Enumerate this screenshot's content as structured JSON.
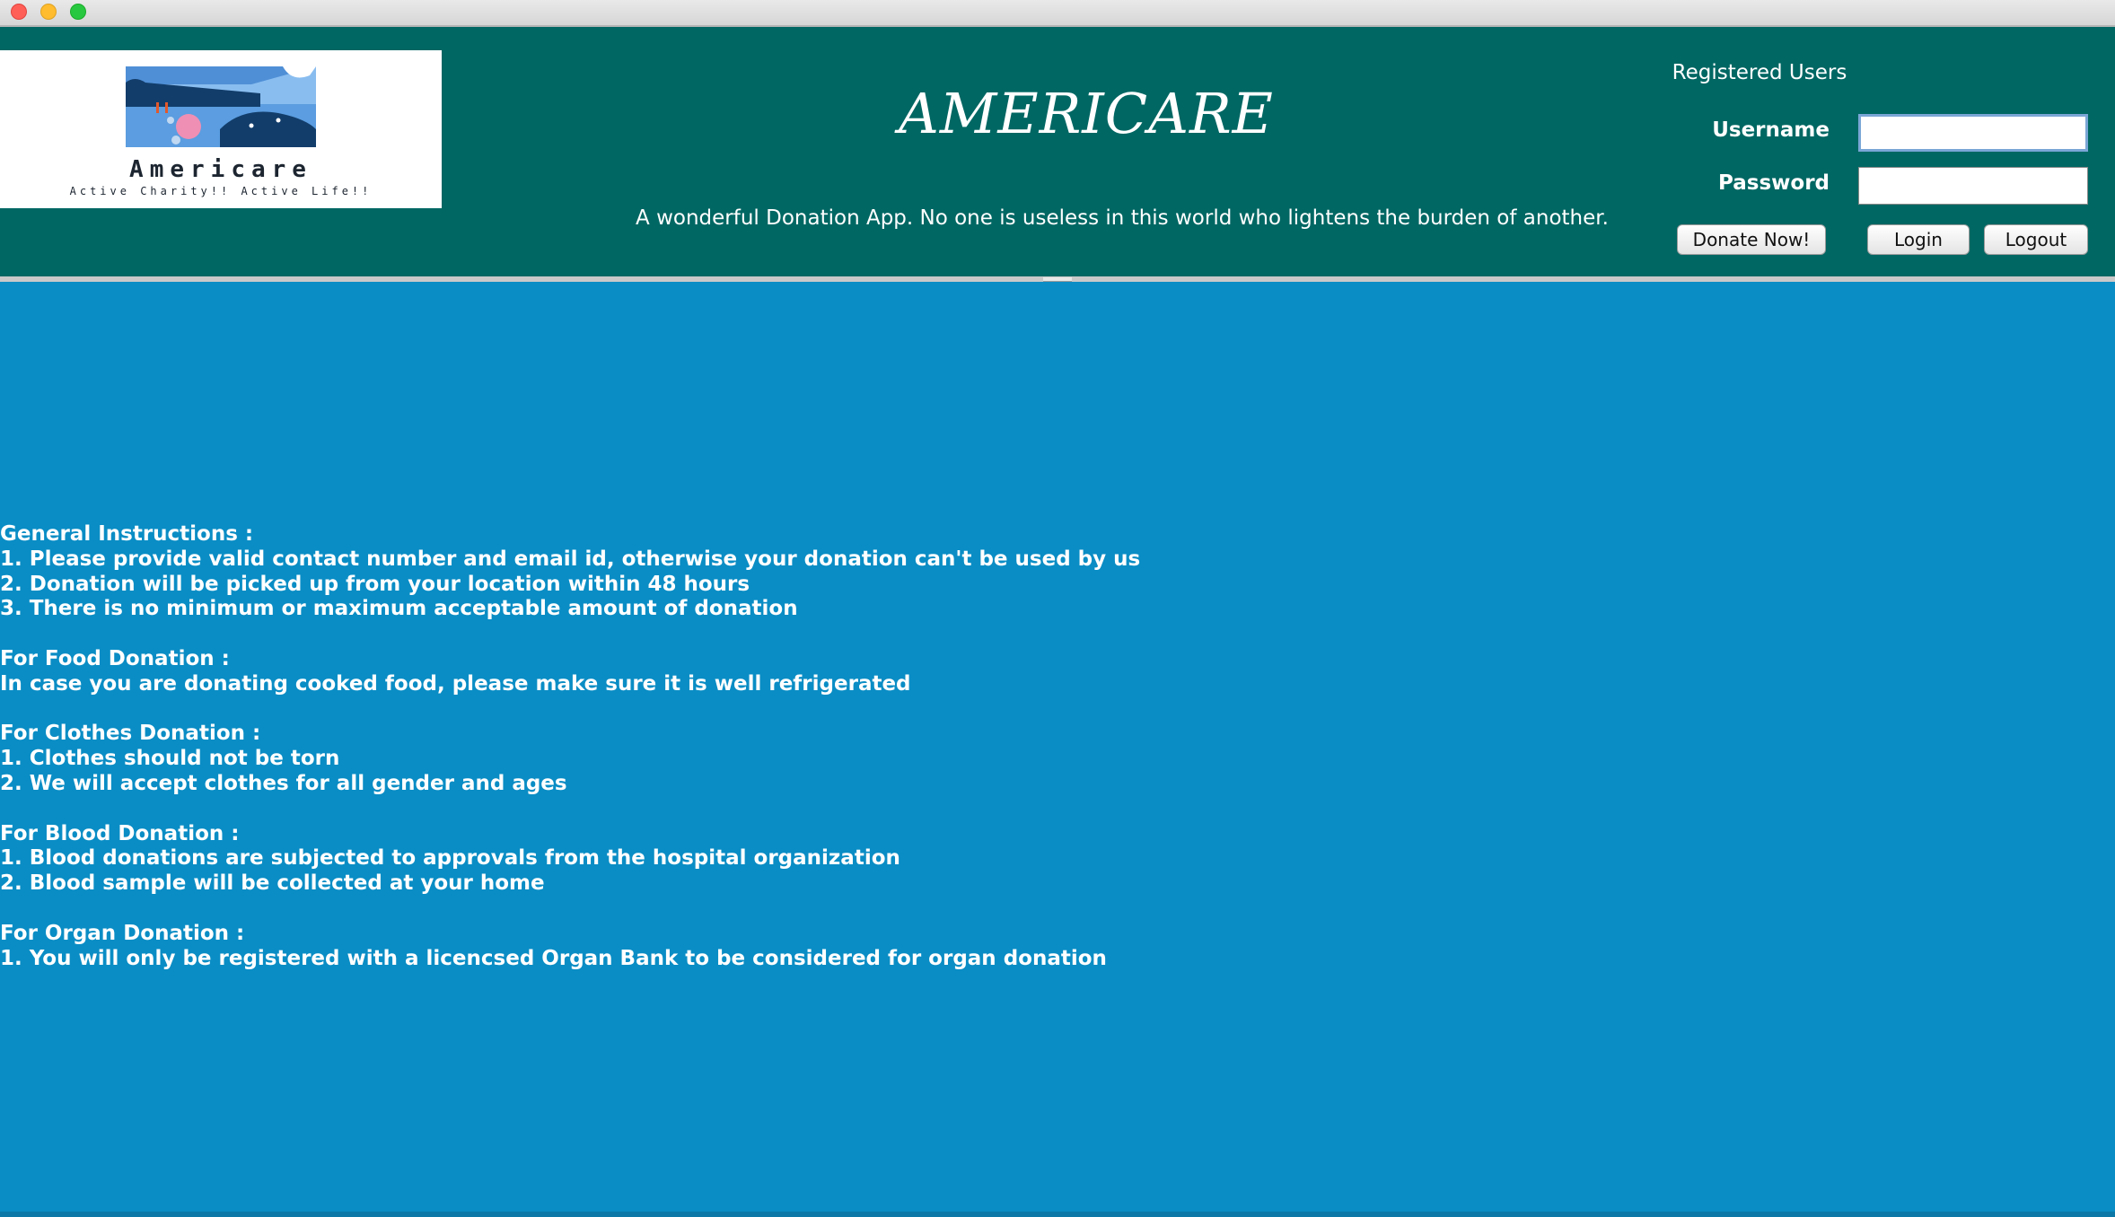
{
  "header": {
    "logo": {
      "name": "Americare",
      "tagline": "Active Charity!! Active Life!!"
    },
    "title": "AMERICARE",
    "tagline": "A wonderful Donation App. No one is useless in this world who lightens the burden of another."
  },
  "login": {
    "heading": "Registered Users",
    "username_label": "Username",
    "password_label": "Password",
    "username_value": "",
    "password_value": "",
    "donate_label": "Donate Now!",
    "login_label": "Login",
    "logout_label": "Logout"
  },
  "instructions": [
    {
      "heading": "General Instructions :",
      "lines": [
        "1. Please provide valid contact number and email id, otherwise your donation can't be used by us",
        "2. Donation will be picked up from your location within 48 hours",
        "3. There is no minimum or maximum acceptable amount of donation"
      ]
    },
    {
      "heading": "For Food Donation :",
      "lines": [
        "In case you are donating cooked food, please make sure it is well refrigerated"
      ]
    },
    {
      "heading": "For Clothes Donation :",
      "lines": [
        "1. Clothes should not be torn",
        "2. We will accept clothes for all gender and ages"
      ]
    },
    {
      "heading": "For Blood Donation :",
      "lines": [
        "1. Blood donations are subjected to approvals from the hospital organization",
        "2. Blood sample will be collected at your home"
      ]
    },
    {
      "heading": "For Organ Donation :",
      "lines": [
        "1. You will only be registered with a licencsed Organ Bank to be considered for organ donation"
      ]
    }
  ],
  "colors": {
    "header_bg": "#006763",
    "main_bg": "#0a8dc5",
    "text": "#ffffff"
  }
}
